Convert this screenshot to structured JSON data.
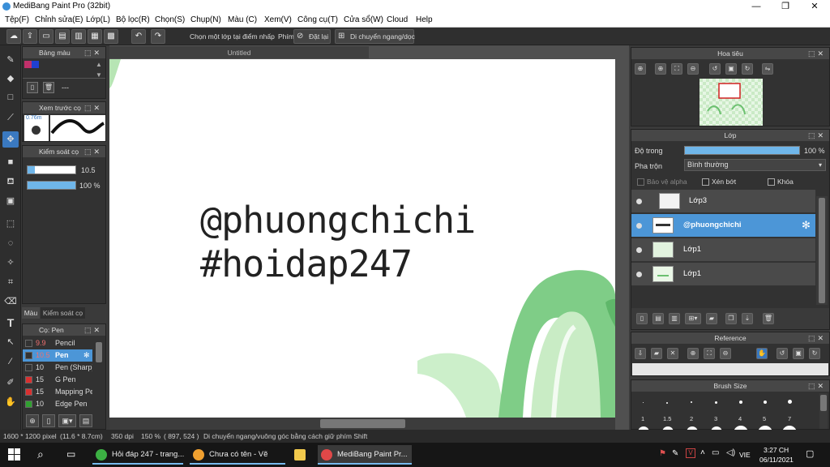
{
  "window": {
    "title": "MediBang Paint Pro (32bit)",
    "controls": {
      "minimize": "—",
      "maximize": "❐",
      "close": "✕"
    }
  },
  "menu": [
    "Tệp(F)",
    "Chỉnh sửa(E)",
    "Lớp(L)",
    "Bộ lọc(R)",
    "Chọn(S)",
    "Chụp(N)",
    "Màu (C)",
    "Xem(V)",
    "Công cụ(T)",
    "Cửa sổ(W)",
    "Cloud",
    "Help"
  ],
  "toolbar": {
    "select_layer_label": "Chọn một lớp tại điểm nhấp",
    "pen_label": "Phím",
    "reset_label": "Đặt lại",
    "move_mode_label": "Di chuyển ngang/dọc"
  },
  "panels": {
    "color_palette": {
      "title": "Bảng màu",
      "placeholder": "---",
      "swatch_colors": [
        "#c0306a",
        "#2040d0"
      ]
    },
    "brush_preview": {
      "title": "Xem trước cọ",
      "size": "0.76m"
    },
    "brush_control": {
      "title": "Kiểm soát cọ",
      "size_value": "10.5",
      "opacity_value": "100 %",
      "opacity_fraction": 1.0
    },
    "left_tabs": [
      "Màu",
      "Kiểm soát cọ"
    ],
    "brush_list": {
      "title": "Cọ: Pen",
      "items": [
        {
          "size": "9.9",
          "name": "Pencil",
          "color": "#333333"
        },
        {
          "size": "10.5",
          "name": "Pen",
          "color": "#333333",
          "selected": true
        },
        {
          "size": "10",
          "name": "Pen (Sharp)",
          "color": "#333333"
        },
        {
          "size": "15",
          "name": "G Pen",
          "color": "#d83030"
        },
        {
          "size": "15",
          "name": "Mapping Pen",
          "color": "#d83030"
        },
        {
          "size": "10",
          "name": "Edge Pen",
          "color": "#30a030"
        }
      ]
    },
    "navigator": {
      "title": "Hoa tiêu"
    },
    "layers": {
      "title": "Lớp",
      "opacity_label": "Độ trong",
      "opacity_value": "100 %",
      "opacity_fraction": 1.0,
      "blend_label": "Pha trộn",
      "blend_value": "Bình thường",
      "alpha_protect": "Bảo vệ alpha",
      "clipping": "Xén bớt",
      "lock": "Khóa",
      "items": [
        {
          "name": "Lớp3",
          "selected": false
        },
        {
          "name": "@phuongchichi",
          "selected": true
        },
        {
          "name": "Lớp1",
          "selected": false
        },
        {
          "name": "Lớp1",
          "selected": false
        }
      ]
    },
    "reference": {
      "title": "Reference"
    },
    "brush_size": {
      "title": "Brush Size",
      "sizes": [
        "1",
        "1.5",
        "2",
        "3",
        "4",
        "5",
        "7"
      ]
    }
  },
  "document": {
    "tab_title": "Untitled",
    "canvas_text_line1": "@phuongchichi",
    "canvas_text_line2": "#hoidap247"
  },
  "status": {
    "dimensions": "1600 * 1200 pixel",
    "physical": "(11.6 * 8.7cm)",
    "dpi": "350 dpi",
    "zoom": "150 %",
    "coords": "( 897, 524 )",
    "hint": "Di chuyển ngang/vuông góc bằng cách giữ phím Shift"
  },
  "taskbar": {
    "apps": [
      {
        "label": "Hỏi đáp 247 - trang...",
        "color": "#3cb043"
      },
      {
        "label": "Chưa có tên - Vẽ",
        "color": "#f0a030"
      },
      {
        "label": "",
        "color": "#f2c94c"
      },
      {
        "label": "MediBang Paint Pr...",
        "color": "#e04848"
      }
    ],
    "language": "VIE",
    "time": "3:27 CH",
    "date": "06/11/2021"
  }
}
